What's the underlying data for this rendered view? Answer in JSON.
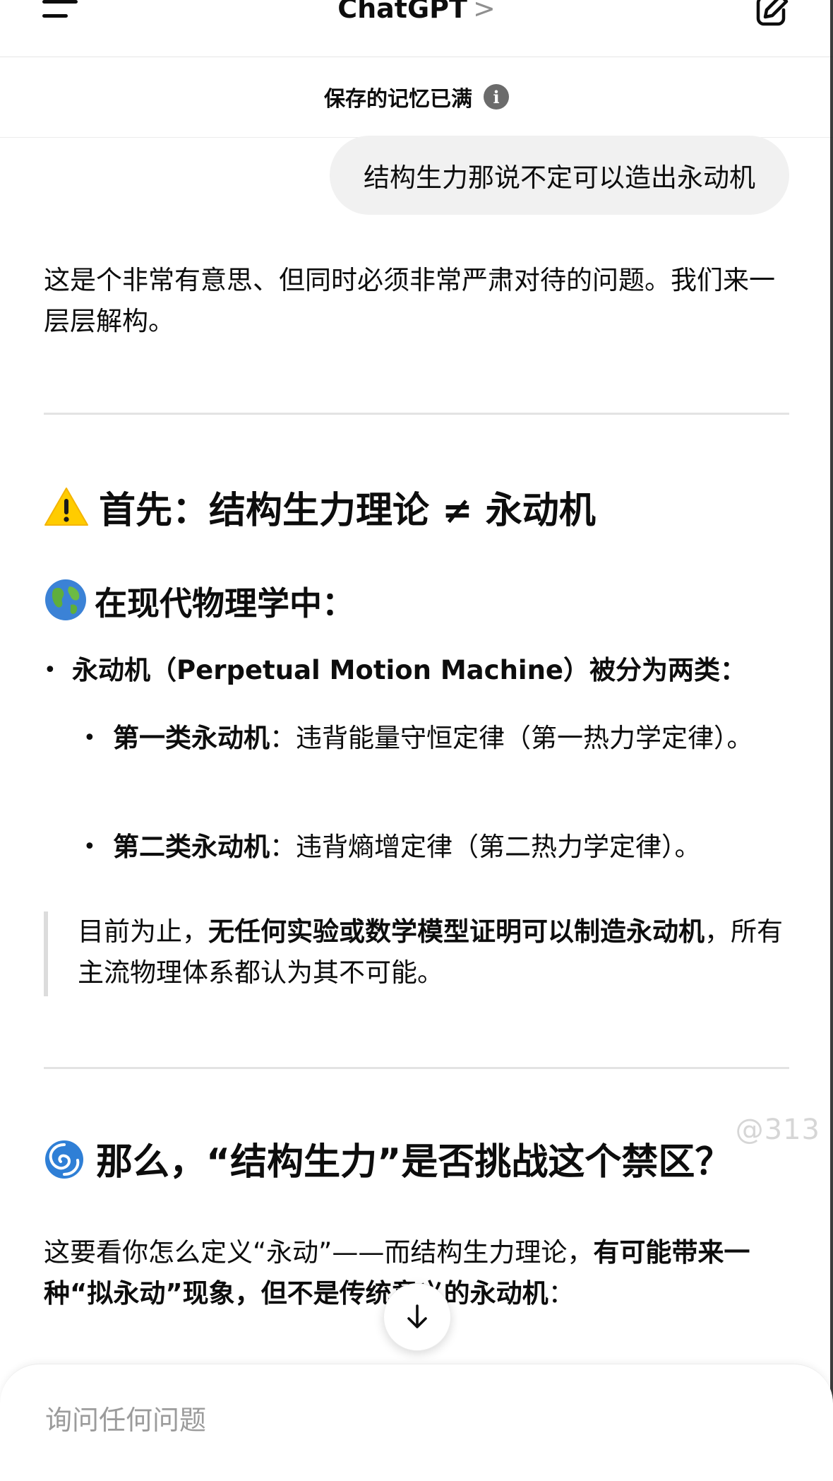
{
  "header": {
    "title": "ChatGPT",
    "title_chevron": ">",
    "menu_icon": "menu-icon",
    "new_chat_icon": "compose-icon"
  },
  "memory_notice": {
    "text": "保存的记忆已满",
    "info_icon": "info-icon",
    "info_glyph": "i"
  },
  "conversation": {
    "user_message": "结构生力那说不定可以造出永动机",
    "assistant": {
      "intro": "这是个非常有意思、但同时必须非常严肃对待的问题。我们来一层层解构。",
      "section1": {
        "emoji": "warning",
        "heading": "首先：结构生力理论 ≠ 永动机"
      },
      "section1_sub": {
        "emoji": "globe",
        "heading": "在现代物理学中："
      },
      "bullet_main": "永动机（Perpetual Motion Machine）被分为两类：",
      "sub_bullets": [
        {
          "bold": "第一类永动机",
          "text": "：违背能量守恒定律（第一热力学定律）。"
        },
        {
          "bold": "第二类永动机",
          "text": "：违背熵增定律（第二热力学定律）。"
        }
      ],
      "quote": {
        "prefix": "目前为止，",
        "bold": "无任何实验或数学模型证明可以制造永动机",
        "suffix": "，所有主流物理体系都认为其不可能。"
      },
      "section2": {
        "emoji": "cyclone",
        "heading": "那么，“结构生力”是否挑战这个禁区？"
      },
      "section2_para": {
        "text": "这要看你怎么定义“永动”——而结构生力理论，",
        "bold": "有可能带来一种“拟永动”现象，但不是传统意义的永动机",
        "suffix": "："
      }
    }
  },
  "watermark": "@313",
  "scroll_button_icon": "arrow-down-icon",
  "composer": {
    "placeholder": "询问任何问题"
  }
}
